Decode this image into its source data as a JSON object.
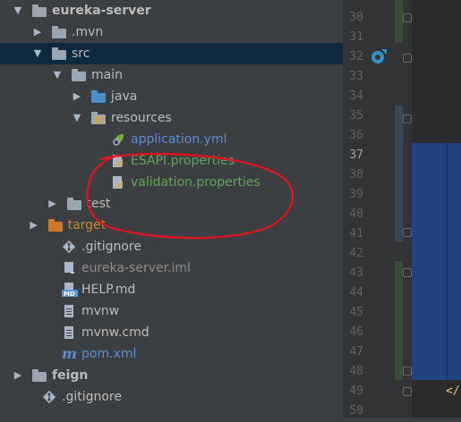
{
  "tree": {
    "items": [
      {
        "label": "eureka-server",
        "indent": 0,
        "arrow": "▼",
        "icon": "module",
        "bold": true,
        "color": ""
      },
      {
        "label": ".mvn",
        "indent": 1,
        "arrow": "▶",
        "icon": "folder",
        "color": ""
      },
      {
        "label": "src",
        "indent": 1,
        "arrow": "▼",
        "icon": "folder",
        "color": "",
        "selected": true
      },
      {
        "label": "main",
        "indent": 2,
        "arrow": "▼",
        "icon": "folder",
        "color": ""
      },
      {
        "label": "java",
        "indent": 3,
        "arrow": "▶",
        "icon": "folder-blue",
        "color": ""
      },
      {
        "label": "resources",
        "indent": 3,
        "arrow": "▼",
        "icon": "resources",
        "color": ""
      },
      {
        "label": "application.yml",
        "indent": 4,
        "arrow": "",
        "icon": "yml",
        "color": "blue"
      },
      {
        "label": "ESAPI.properties",
        "indent": 4,
        "arrow": "",
        "icon": "properties",
        "color": "green"
      },
      {
        "label": "validation.properties",
        "indent": 4,
        "arrow": "",
        "icon": "properties",
        "color": "green"
      },
      {
        "label": "test",
        "indent": 1.75,
        "arrow": "▶",
        "icon": "folder",
        "color": ""
      },
      {
        "label": "target",
        "indent": 0.8,
        "arrow": "▶",
        "icon": "folder-orange",
        "color": "orange"
      },
      {
        "label": ".gitignore",
        "indent": 1.5,
        "arrow": "",
        "icon": "git",
        "color": ""
      },
      {
        "label": "eureka-server.iml",
        "indent": 1.5,
        "arrow": "",
        "icon": "iml",
        "color": "gray"
      },
      {
        "label": "HELP.md",
        "indent": 1.5,
        "arrow": "",
        "icon": "md",
        "color": ""
      },
      {
        "label": "mvnw",
        "indent": 1.5,
        "arrow": "",
        "icon": "file",
        "color": ""
      },
      {
        "label": "mvnw.cmd",
        "indent": 1.5,
        "arrow": "",
        "icon": "file",
        "color": ""
      },
      {
        "label": "pom.xml",
        "indent": 1.5,
        "arrow": "",
        "icon": "maven",
        "color": "blue"
      },
      {
        "label": "feign",
        "indent": 0,
        "arrow": "▶",
        "icon": "module",
        "bold": true,
        "color": ""
      },
      {
        "label": ".gitignore",
        "indent": 0.5,
        "arrow": "",
        "icon": "git",
        "color": ""
      }
    ]
  },
  "gutter": {
    "line_numbers": [
      "30",
      "31",
      "32",
      "33",
      "34",
      "35",
      "36",
      "37",
      "38",
      "39",
      "40",
      "41",
      "42",
      "43",
      "44",
      "45",
      "46",
      "47",
      "48",
      "49",
      "50"
    ],
    "current_line": "37"
  },
  "editor": {
    "closing_tag": "</"
  },
  "colors": {
    "selection": "#0d293e",
    "annotation": "#e3131b",
    "highlight_block": "#214283"
  }
}
